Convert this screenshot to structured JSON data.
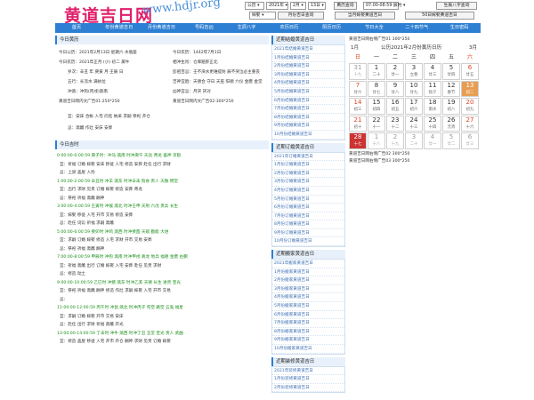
{
  "header": {
    "logo": "黄道吉日网",
    "url": "www.hdjr.org",
    "calendar_type": "公历",
    "year": "2021年",
    "month": "2月",
    "day": "13日",
    "time": "07:00-08:59 辰时",
    "gender": "嫁娶",
    "buttons": [
      "黄历查询",
      "生辰八字查询",
      "月份吉日查询",
      "当月嫁娶黄道吉日",
      "50日嫁娶黄道吉日"
    ]
  },
  "nav": [
    "首页",
    "年份黄道吉日",
    "月份黄道吉日",
    "号码吉凶",
    "生辰八字",
    "农历日历",
    "阳历日历",
    "节日大全",
    "二十四节气",
    "生日密码"
  ],
  "today": {
    "title": "今日黄历",
    "solar": "今日公历：2021年2月13日 星期六 水瓶座",
    "ad1": "今日农历：1442年7月1日",
    "lunar": "今日农历：2021年正月 (小) 初二 属牛",
    "chong": "彭祖百忌：壬不泱水更难提防 辰不哭泣必主重丧",
    "chong_l": "相冲生肖：仓库赔肝正北",
    "sui": "岁次：辛丑 年 庚寅 月 壬辰 日",
    "jishen": "吉神宜趋：天德合 守日 天巫 阳德 六仪 金匮 金堂",
    "wuxing": "五行：长流水 满执位",
    "xiongshen": "凶神宜忌：月厌 厌对",
    "chongsha": "冲煞：冲狗(丙戌)煞南",
    "ad2": "黄道吉日网内文广告01:250*250",
    "ad3": "黄道吉日网内文广告02:300*250",
    "yi": "宜：安床 合帐 入宅 问名 纳采 求嗣 祭祀 开仓",
    "ji": "忌：斋醮 作灶 安床 安葬"
  },
  "hours": {
    "title": "今日吉时",
    "items": [
      {
        "time": "0:00:00-0:00:59 庚子时：冲马 煞南 时冲庚午 天兵 青龙 喜神 贪狼",
        "yi": "宜：祈福 订婚 嫁娶 安床 移徙 入宅 修造 安葬 赴任 出行 求财",
        "ji": "忌：上梁 盖屋 入殓"
      },
      {
        "time": "1:00:00-2:00:59 辛丑时 冲羊 煞东 时冲辛未 狗食 贵人 天赦 明堂",
        "yi": "宜：出行 求财 见贵 订婚 嫁娶 修造 安葬 青龙",
        "ji": "忌：祭祀 祈福 斋醮 酬神"
      },
      {
        "time": "3:00:00-4:00:59 壬寅时 冲猴 煞北 时冲壬申 天刑 六戊 贵兵 长生",
        "yi": "宜：嫁娶 移徙 入宅 开市 交易 修造 安葬",
        "ji": "忌：赴任 词讼 祈福 求嗣 斋醮"
      },
      {
        "time": "5:00:00-6:00:59 癸卯时 冲鸡 煞西 时冲癸酉 天赋 勤能 大进",
        "yi": "宜：求嗣 订婚 嫁娶 修造 入宅 求财 开市 交易 安葬",
        "ji": "忌：祭祀 祈福 斋醮 酬神"
      },
      {
        "time": "7:00:00-8:00:59 甲辰时 冲狗 煞南 时冲甲戌 真龙 地兵 福德 金匮 右弼",
        "yi": "宜：祈福 斋醮 出行 订婚 嫁娶 入宅 安葬 赴任 见贵 求财",
        "ji": "忌：修造 动土"
      },
      {
        "time": "9:00:00-10:00:59 乙巳时 冲猪 煞东 时冲乙亥 天德 长生 进贵 宝光",
        "yi": "宜：祭祀 祈福 斋醮 酬神 修造 作灶 求嗣 嫁娶 入宅 开市 交易",
        "ji": "忌："
      },
      {
        "time": "11:00:00-12:00:59 丙午时 冲鼠 煞北 时冲丙子 旬空 路空 五鬼 福星",
        "yi": "宜：求嗣 订婚 嫁娶 开市 交易 安床",
        "ji": "忌：赴任 出行 求财 祈福 斋醮 开光"
      },
      {
        "time": "13:00:00-14:00:59 丁未时 冲牛 煞西 时冲丁丑 玉堂 宝光 贵人 武曲",
        "yi": "宜：修造 盖屋 移徙 入宅 开市 开仓 酬神 求财 见贵 订婚 嫁娶",
        "ji": ""
      }
    ]
  },
  "middle": {
    "lists": [
      {
        "title": "近期结婚黄道吉日",
        "items": [
          "2021年结婚黄道吉日",
          "1月份结婚黄道吉日",
          "2月份结婚黄道吉日",
          "3月份结婚黄道吉日",
          "4月份结婚黄道吉日",
          "5月份结婚黄道吉日",
          "6月份结婚黄道吉日",
          "7月份结婚黄道吉日",
          "8月份结婚黄道吉日",
          "9月份结婚黄道吉日",
          "10月份结婚黄道吉日"
        ]
      },
      {
        "title": "近期订婚黄道吉日",
        "items": [
          "2021年订婚黄道吉日",
          "1月份订婚黄道吉日",
          "2月份订婚黄道吉日",
          "3月份订婚黄道吉日",
          "4月份订婚黄道吉日",
          "5月份订婚黄道吉日",
          "6月份订婚黄道吉日",
          "7月份订婚黄道吉日",
          "8月份订婚黄道吉日",
          "9月份订婚黄道吉日",
          "10月份订婚黄道吉日"
        ]
      },
      {
        "title": "近期搬家黄道吉日",
        "items": [
          "2021年搬家黄道吉日",
          "1月份搬家黄道吉日",
          "2月份搬家黄道吉日",
          "3月份搬家黄道吉日",
          "4月份搬家黄道吉日",
          "5月份搬家黄道吉日",
          "6月份搬家黄道吉日",
          "7月份搬家黄道吉日",
          "8月份搬家黄道吉日",
          "9月份搬家黄道吉日",
          "10月份搬家黄道吉日"
        ]
      },
      {
        "title": "近期装修黄道吉日",
        "items": [
          "2021年装修黄道吉日",
          "1月份装修黄道吉日",
          "2月份装修黄道吉日"
        ]
      }
    ]
  },
  "right": {
    "ad_top": "黄道吉日网右侧广告01 300*250",
    "cal_left": "1月",
    "cal_title": "公历2021年2月份黄历日历",
    "cal_right": "3月",
    "weekdays": [
      "日",
      "一",
      "二",
      "三",
      "四",
      "五",
      "六"
    ],
    "cells": [
      {
        "n": "31",
        "l": "十九",
        "c": "other"
      },
      {
        "n": "1",
        "l": "二十",
        "c": ""
      },
      {
        "n": "2",
        "l": "廿一",
        "c": ""
      },
      {
        "n": "3",
        "l": "立春",
        "c": ""
      },
      {
        "n": "4",
        "l": "廿三",
        "c": ""
      },
      {
        "n": "5",
        "l": "廿四",
        "c": ""
      },
      {
        "n": "6",
        "l": "廿五",
        "c": "weekend"
      },
      {
        "n": "7",
        "l": "廿六",
        "c": "weekend"
      },
      {
        "n": "8",
        "l": "廿七",
        "c": ""
      },
      {
        "n": "9",
        "l": "廿八",
        "c": ""
      },
      {
        "n": "10",
        "l": "廿九",
        "c": ""
      },
      {
        "n": "11",
        "l": "除夕",
        "c": ""
      },
      {
        "n": "12",
        "l": "春节",
        "c": ""
      },
      {
        "n": "13",
        "l": "初二",
        "c": "today"
      },
      {
        "n": "14",
        "l": "初三",
        "c": "weekend"
      },
      {
        "n": "15",
        "l": "初四",
        "c": ""
      },
      {
        "n": "16",
        "l": "初五",
        "c": ""
      },
      {
        "n": "17",
        "l": "初六",
        "c": ""
      },
      {
        "n": "18",
        "l": "雨水",
        "c": ""
      },
      {
        "n": "19",
        "l": "初八",
        "c": ""
      },
      {
        "n": "20",
        "l": "初九",
        "c": "weekend"
      },
      {
        "n": "21",
        "l": "初十",
        "c": "weekend"
      },
      {
        "n": "22",
        "l": "十一",
        "c": ""
      },
      {
        "n": "23",
        "l": "十二",
        "c": ""
      },
      {
        "n": "24",
        "l": "十三",
        "c": ""
      },
      {
        "n": "25",
        "l": "十四",
        "c": ""
      },
      {
        "n": "26",
        "l": "元宵",
        "c": ""
      },
      {
        "n": "27",
        "l": "十六",
        "c": "weekend"
      },
      {
        "n": "28",
        "l": "十七",
        "c": "red"
      },
      {
        "n": "1",
        "l": "十八",
        "c": "other"
      },
      {
        "n": "2",
        "l": "十九",
        "c": "other"
      },
      {
        "n": "3",
        "l": "二十",
        "c": "other"
      },
      {
        "n": "4",
        "l": "廿一",
        "c": "other"
      },
      {
        "n": "5",
        "l": "廿二",
        "c": "other"
      },
      {
        "n": "6",
        "l": "廿三",
        "c": "other"
      }
    ],
    "ad_mid": "黄道吉日网右侧广告02 300*250",
    "ad_bot": "黄道吉日网右侧广告03 300*250"
  }
}
